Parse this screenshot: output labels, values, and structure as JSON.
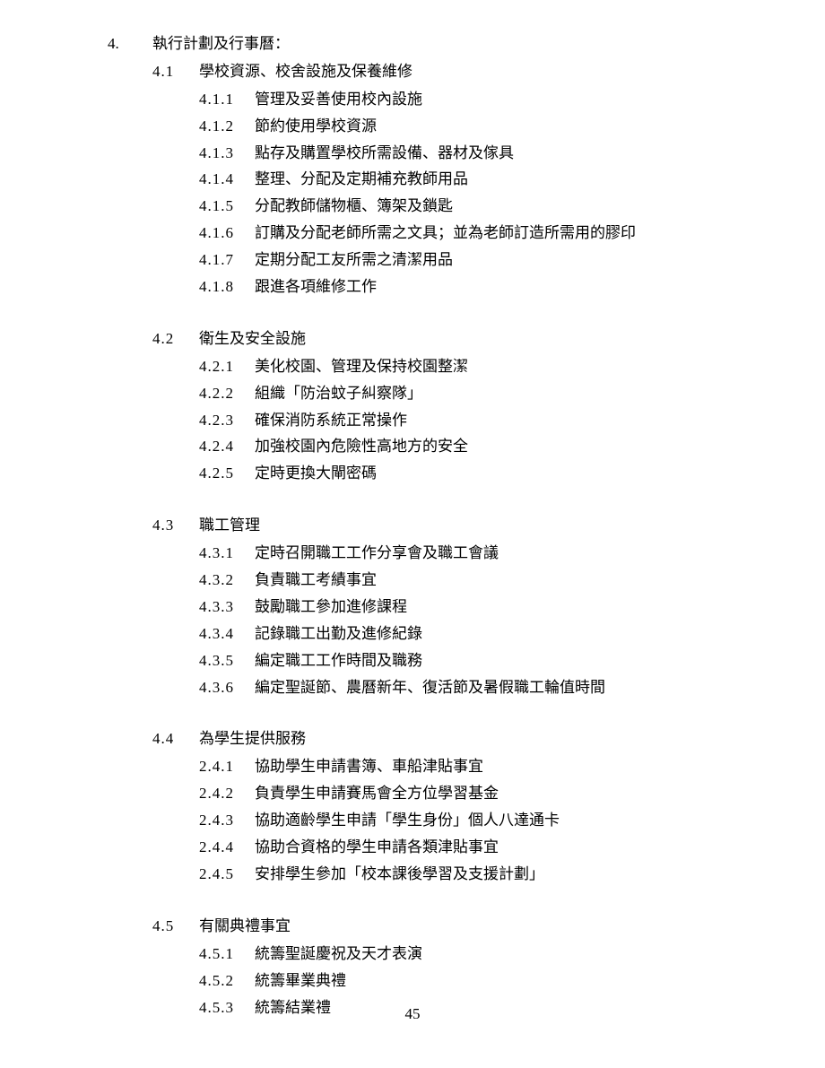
{
  "section": {
    "number": "4.",
    "title": "執行計劃及行事曆："
  },
  "subsections": [
    {
      "number": "4.1",
      "title": "學校資源、校舍設施及保養維修",
      "items": [
        {
          "number": "4.1.1",
          "text": "管理及妥善使用校內設施"
        },
        {
          "number": "4.1.2",
          "text": "節約使用學校資源"
        },
        {
          "number": "4.1.3",
          "text": "點存及購置學校所需設備、器材及傢具"
        },
        {
          "number": "4.1.4",
          "text": "整理、分配及定期補充教師用品"
        },
        {
          "number": "4.1.5",
          "text": "分配教師儲物櫃、簿架及鎖匙"
        },
        {
          "number": "4.1.6",
          "text": "訂購及分配老師所需之文具；並為老師訂造所需用的膠印"
        },
        {
          "number": "4.1.7",
          "text": "定期分配工友所需之清潔用品"
        },
        {
          "number": "4.1.8",
          "text": "跟進各項維修工作"
        }
      ]
    },
    {
      "number": "4.2",
      "title": "衛生及安全設施",
      "items": [
        {
          "number": "4.2.1",
          "text": "美化校園、管理及保持校園整潔"
        },
        {
          "number": "4.2.2",
          "text": "組織「防治蚊子糾察隊」"
        },
        {
          "number": "4.2.3",
          "text": "確保消防系統正常操作"
        },
        {
          "number": "4.2.4",
          "text": "加強校園內危險性高地方的安全"
        },
        {
          "number": "4.2.5",
          "text": "定時更換大閘密碼"
        }
      ]
    },
    {
      "number": "4.3",
      "title": "職工管理",
      "items": [
        {
          "number": "4.3.1",
          "text": "定時召開職工工作分享會及職工會議"
        },
        {
          "number": "4.3.2",
          "text": "負責職工考績事宜"
        },
        {
          "number": "4.3.3",
          "text": "鼓勵職工參加進修課程"
        },
        {
          "number": "4.3.4",
          "text": "記錄職工出勤及進修紀錄"
        },
        {
          "number": "4.3.5",
          "text": "編定職工工作時間及職務"
        },
        {
          "number": "4.3.6",
          "text": "編定聖誕節、農曆新年、復活節及暑假職工輪值時間"
        }
      ]
    },
    {
      "number": "4.4",
      "title": "為學生提供服務",
      "items": [
        {
          "number": "2.4.1",
          "text": "協助學生申請書簿、車船津貼事宜"
        },
        {
          "number": "2.4.2",
          "text": "負責學生申請賽馬會全方位學習基金"
        },
        {
          "number": "2.4.3",
          "text": "協助適齡學生申請「學生身份」個人八達通卡"
        },
        {
          "number": "2.4.4",
          "text": "協助合資格的學生申請各類津貼事宜"
        },
        {
          "number": "2.4.5",
          "text": "安排學生參加「校本課後學習及支援計劃」"
        }
      ]
    },
    {
      "number": "4.5",
      "title": "有關典禮事宜",
      "items": [
        {
          "number": "4.5.1",
          "text": "統籌聖誕慶祝及天才表演"
        },
        {
          "number": "4.5.2",
          "text": "統籌畢業典禮"
        },
        {
          "number": "4.5.3",
          "text": "統籌結業禮"
        }
      ]
    }
  ],
  "pageNumber": "45"
}
